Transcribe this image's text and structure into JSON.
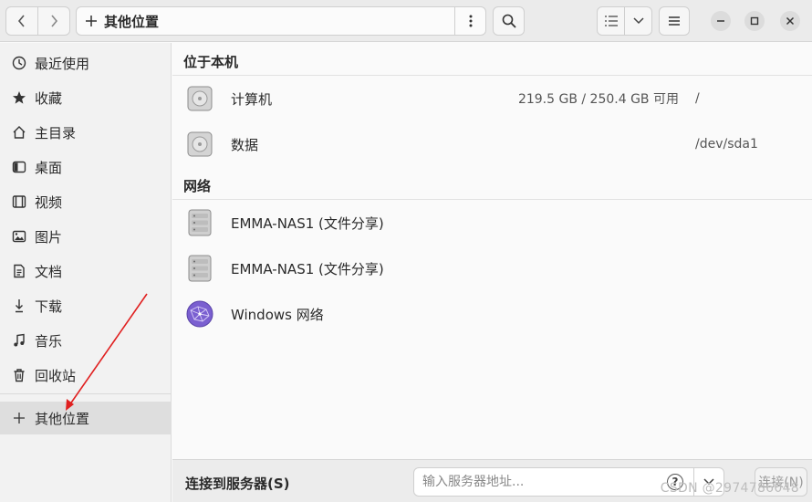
{
  "header": {
    "path_title": "其他位置",
    "icons": [
      "chevron-left-icon",
      "chevron-right-icon",
      "plus-icon",
      "more-vertical-icon",
      "search-icon",
      "list-view-icon",
      "chevron-down-icon",
      "hamburger-menu-icon",
      "minimize-icon",
      "maximize-icon",
      "close-icon"
    ]
  },
  "sidebar": {
    "items": [
      {
        "label": "最近使用",
        "icon": "clock-icon"
      },
      {
        "label": "收藏",
        "icon": "star-icon"
      },
      {
        "label": "主目录",
        "icon": "home-icon"
      },
      {
        "label": "桌面",
        "icon": "desktop-icon"
      },
      {
        "label": "视频",
        "icon": "film-icon"
      },
      {
        "label": "图片",
        "icon": "image-icon"
      },
      {
        "label": "文档",
        "icon": "document-icon"
      },
      {
        "label": "下载",
        "icon": "download-icon"
      },
      {
        "label": "音乐",
        "icon": "music-icon"
      },
      {
        "label": "回收站",
        "icon": "trash-icon"
      },
      {
        "label": "其他位置",
        "icon": "plus-icon"
      }
    ]
  },
  "main": {
    "local_section": {
      "title": "位于本机",
      "rows": [
        {
          "name": "计算机",
          "info": "219.5 GB / 250.4 GB 可用",
          "path": "/"
        },
        {
          "name": "数据",
          "info": "",
          "path": "/dev/sda1"
        }
      ]
    },
    "network_section": {
      "title": "网络",
      "rows": [
        {
          "name": "EMMA-NAS1 (文件分享)"
        },
        {
          "name": "EMMA-NAS1 (文件分享)"
        },
        {
          "name": "Windows 网络"
        }
      ]
    }
  },
  "bottom": {
    "connect_label": "连接到服务器(S)",
    "server_placeholder": "输入服务器地址...",
    "help_glyph": "?",
    "connect_button": "连接(N)"
  },
  "watermark": "CSDN @2974786048",
  "colors": {
    "accent_arrow": "#e02020",
    "sidebar_active": "#dedede",
    "network_globe": "#7a5fd0"
  }
}
